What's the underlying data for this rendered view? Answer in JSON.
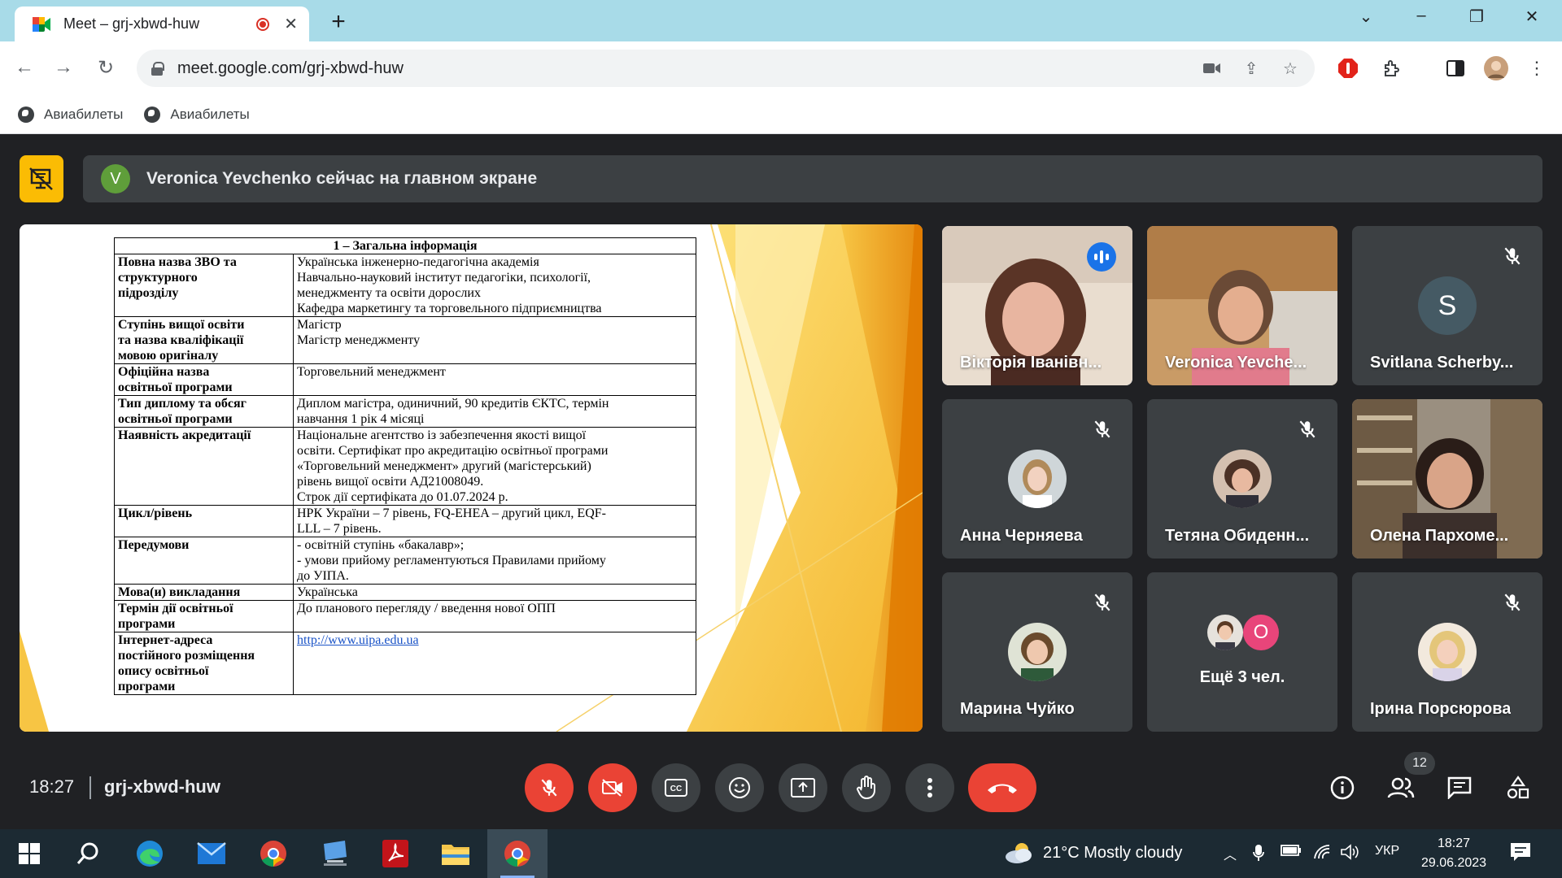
{
  "browser": {
    "tab_title": "Meet – grj-xbwd-huw",
    "url": "meet.google.com/grj-xbwd-huw",
    "bookmarks": [
      "Авиабилеты",
      "Авиабилеты"
    ]
  },
  "meet": {
    "banner_text": "Veronica Yevchenko сейчас на главном экране",
    "presenter_initial": "V",
    "time": "18:27",
    "meeting_code": "grj-xbwd-huw",
    "participants_count": "12",
    "participants": [
      {
        "name": "Вікторія Іванівн...",
        "state": "speaking"
      },
      {
        "name": "Veronica Yevche...",
        "state": "video"
      },
      {
        "name": "Svitlana Scherby...",
        "state": "muted",
        "initial": "S"
      },
      {
        "name": "Анна Черняева",
        "state": "muted"
      },
      {
        "name": "Тетяна Обиденн...",
        "state": "muted"
      },
      {
        "name": "Олена Пархоме...",
        "state": "video"
      },
      {
        "name": "Марина Чуйко",
        "state": "muted"
      },
      {
        "name": "Ещё 3 чел.",
        "state": "more",
        "extra_initial": "О"
      },
      {
        "name": "Ірина Порсюрова",
        "state": "muted"
      }
    ]
  },
  "slide": {
    "header": "1 – Загальна інформація",
    "rows": [
      {
        "key": [
          "Повна назва ЗВО та",
          "структурного",
          "підрозділу"
        ],
        "value": [
          "Українська інженерно-педагогічна академія",
          "Навчально-науковий інститут педагогіки, психології,",
          "менеджменту та освіти дорослих",
          "Кафедра маркетингу та торговельного підприємництва"
        ]
      },
      {
        "key": [
          "Ступінь вищої освіти",
          "та назва кваліфікації",
          "мовою оригіналу"
        ],
        "value": [
          "Магістр",
          "Магістр менеджменту"
        ]
      },
      {
        "key": [
          "Офіційна назва",
          "освітньої програми"
        ],
        "value": [
          "Торговельний менеджмент"
        ]
      },
      {
        "key": [
          "Тип диплому та обсяг",
          "освітньої програми"
        ],
        "value": [
          "Диплом магістра, одиничний, 90 кредитів ЄКТС, термін",
          "навчання 1 рік 4 місяці"
        ]
      },
      {
        "key": [
          "Наявність акредитації"
        ],
        "value": [
          "Національне агентство із забезпечення якості вищої",
          "освіти. Сертифікат про акредитацію освітньої програми",
          "«Торговельний менеджмент» другий (магістерський)",
          "рівень вищої освіти АД21008049.",
          "Строк дії сертифіката до 01.07.2024 р."
        ]
      },
      {
        "key": [
          "Цикл/рівень"
        ],
        "value": [
          "НРК України – 7 рівень, FQ-EHEA – другий цикл, EQF-",
          "LLL – 7 рівень."
        ]
      },
      {
        "key": [
          "Передумови"
        ],
        "value": [
          "- освітній ступінь «бакалавр»;",
          "- умови прийому регламентуються Правилами прийому",
          "до УІПА."
        ]
      },
      {
        "key": [
          "Мова(и) викладання"
        ],
        "value": [
          "Українська"
        ]
      },
      {
        "key": [
          "Термін дії освітньої",
          "програми"
        ],
        "value": [
          "До планового перегляду / введення нової ОПП"
        ]
      },
      {
        "key": [
          "Інтернет-адреса",
          "постійного розміщення",
          "опису освітньої",
          "програми"
        ],
        "value": [
          "http://www.uipa.edu.ua"
        ],
        "link": true
      }
    ]
  },
  "taskbar": {
    "weather": "21°C  Mostly cloudy",
    "lang": "УКР",
    "time": "18:27",
    "date": "29.06.2023"
  },
  "colors": {
    "meet_bg": "#202124",
    "tile_bg": "#3c4043",
    "red": "#ea4335",
    "accent_blue": "#8ab4f8",
    "warn_yellow": "#fbbc04"
  }
}
